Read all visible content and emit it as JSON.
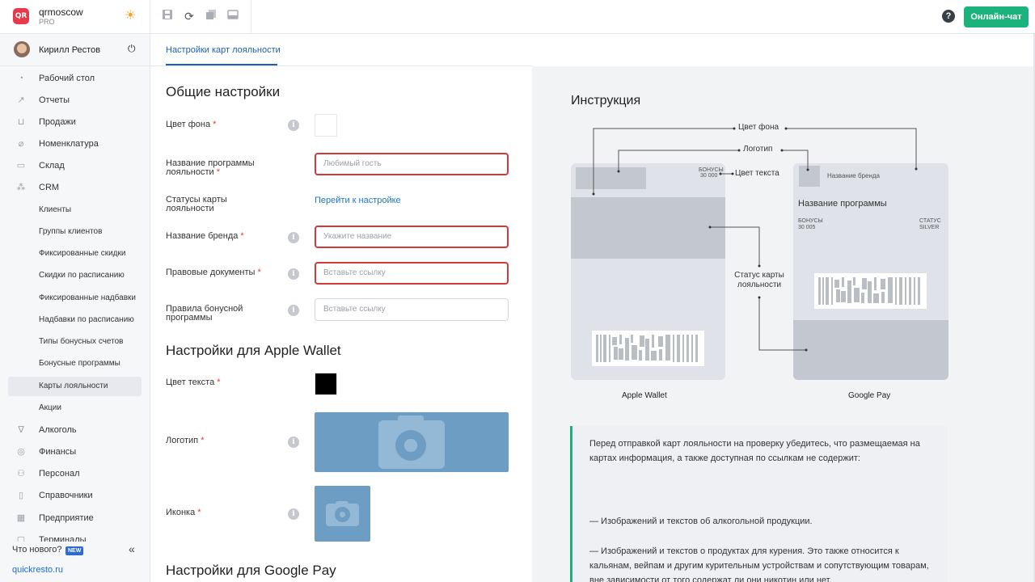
{
  "brand": {
    "name": "qrmoscow",
    "plan": "PRO",
    "logo_text": "QR"
  },
  "header": {
    "help": "?",
    "chat_button": "Онлайн-чат"
  },
  "user": {
    "name": "Кирилл Рестов"
  },
  "sidebar": {
    "items": [
      {
        "label": "Рабочий стол",
        "icon": "dashboard-icon"
      },
      {
        "label": "Отчеты",
        "icon": "chart-icon"
      },
      {
        "label": "Продажи",
        "icon": "cart-icon"
      },
      {
        "label": "Номенклатура",
        "icon": "tag-icon"
      },
      {
        "label": "Склад",
        "icon": "box-icon"
      },
      {
        "label": "CRM",
        "icon": "people-icon"
      },
      {
        "label": "Клиенты"
      },
      {
        "label": "Группы клиентов"
      },
      {
        "label": "Фиксированные скидки"
      },
      {
        "label": "Скидки по расписанию"
      },
      {
        "label": "Фиксированные надбавки"
      },
      {
        "label": "Надбавки по расписанию"
      },
      {
        "label": "Типы бонусных счетов"
      },
      {
        "label": "Бонусные программы"
      },
      {
        "label": "Карты лояльности"
      },
      {
        "label": "Акции"
      },
      {
        "label": "Алкоголь",
        "icon": "glass-icon"
      },
      {
        "label": "Финансы",
        "icon": "coins-icon"
      },
      {
        "label": "Персонал",
        "icon": "staff-icon"
      },
      {
        "label": "Справочники",
        "icon": "book-icon"
      },
      {
        "label": "Предприятие",
        "icon": "building-icon"
      },
      {
        "label": "Терминалы",
        "icon": "terminal-icon"
      }
    ],
    "active": "Карты лояльности",
    "whats_new": "Что нового?",
    "new_badge": "NEW",
    "site": "quickresto.ru"
  },
  "tabs": [
    {
      "label": "Настройки карт лояльности",
      "active": true
    }
  ],
  "general": {
    "title": "Общие настройки",
    "bg_color_label": "Цвет фона",
    "bg_color": "#ffffff",
    "program_name_label": "Название программы лояльности",
    "program_name_placeholder": "Любимый гость",
    "statuses_label": "Статусы карты лояльности",
    "statuses_link": "Перейти к настройке",
    "brand_name_label": "Название бренда",
    "brand_name_placeholder": "Укажите название",
    "legal_docs_label": "Правовые документы",
    "legal_docs_placeholder": "Вставьте ссылку",
    "bonus_rules_label": "Правила бонусной программы",
    "bonus_rules_placeholder": "Вставьте ссылку",
    "required_mark": "*",
    "info_glyph": "i"
  },
  "apple": {
    "title": "Настройки для Apple Wallet",
    "text_color_label": "Цвет текста",
    "text_color": "#000000",
    "logo_label": "Логотип",
    "icon_label": "Иконка"
  },
  "google": {
    "title": "Настройки для Google Pay"
  },
  "instruction": {
    "title": "Инструкция",
    "ann_bg": "Цвет фона",
    "ann_logo": "Логотип",
    "ann_text": "Цвет текста",
    "ann_status": "Статус карты лояльности",
    "apple_caption": "Apple Wallet",
    "google_caption": "Google Pay",
    "apple_card": {
      "bonus_label": "БОНУСЫ",
      "bonus_value": "30 000"
    },
    "google_card": {
      "brand": "Название бренда",
      "program": "Название программы",
      "bonus_label": "БОНУСЫ",
      "bonus_value": "30 005",
      "status_label": "СТАТУС",
      "status_value": "SILVER"
    },
    "notice_intro": "Перед отправкой карт лояльности на проверку убедитесь, что размещаемая на картах информация, а также доступная по ссылкам не содержит:",
    "notice_item1": "— Изображений и текстов об алкогольной продукции.",
    "notice_item2": "— Изображений и текстов о продуктах для курения. Это также относится к кальянам, вейпам и другим курительным устройствам и сопутствующим товарам, вне зависимости от того содержат ли они никотин или нет."
  },
  "colors": {
    "accent": "#1bb27c",
    "link": "#1a76c9",
    "error": "#d03a3a",
    "upload": "#6d9dc2"
  }
}
